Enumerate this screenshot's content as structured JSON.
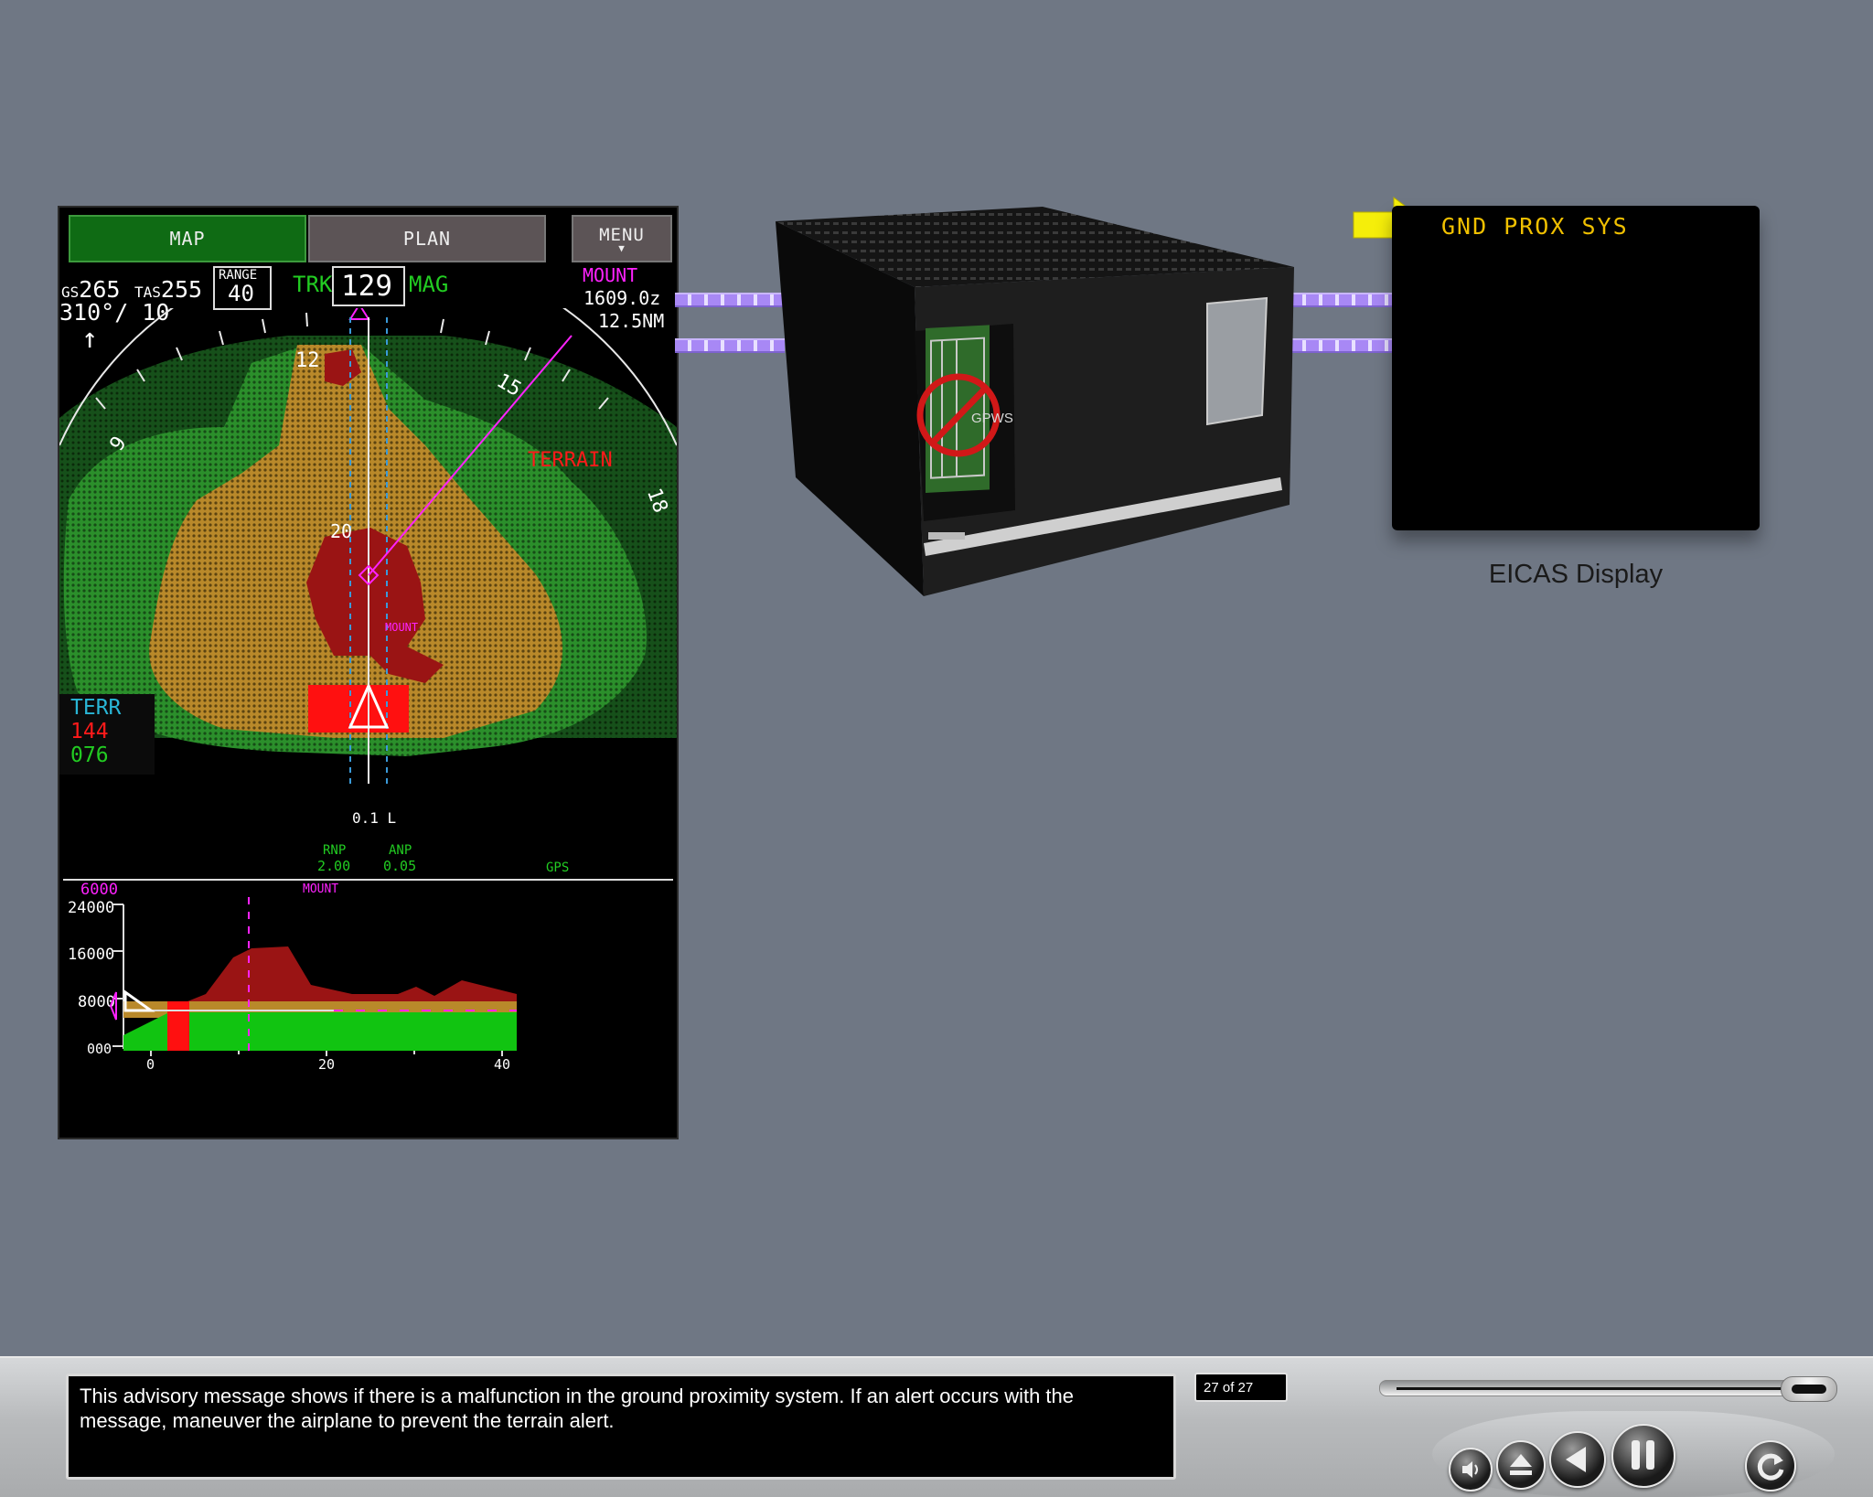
{
  "nd": {
    "buttons": {
      "map": "MAP",
      "plan": "PLAN",
      "menu": "MENU"
    },
    "gs_label": "GS",
    "gs_value": "265",
    "tas_label": "TAS",
    "tas_value": "255",
    "wind": "310°/ 10",
    "range_label": "RANGE",
    "range_value": "40",
    "trk_label": "TRK",
    "heading": "129",
    "mag_label": "MAG",
    "waypoint": {
      "name": "MOUNT",
      "time": "1609.0z",
      "dist": "12.5NM"
    },
    "compass_labels": [
      "12",
      "15",
      "9",
      "18"
    ],
    "terrain_label": "TERRAIN",
    "mount_map_label": "MOUNT",
    "mark_20": "20",
    "terr_box": {
      "label": "TERR",
      "high": "144",
      "low": "076"
    },
    "xtk": "0.1 L",
    "rnp_label": "RNP",
    "rnp_value": "2.00",
    "anp_label": "ANP",
    "anp_value": "0.05",
    "gps": "GPS",
    "vsd": {
      "alt_sel": "6000",
      "mount_label": "MOUNT",
      "y_labels": [
        "24000",
        "16000",
        "8000",
        "000"
      ],
      "x_labels": [
        "0",
        "20",
        "40"
      ]
    }
  },
  "unit_label": "GPWS",
  "eicas": {
    "message": "GND PROX SYS",
    "label": "EICAS Display"
  },
  "footer": {
    "caption": "This advisory message shows if there is a malfunction in the ground proximity system. If an alert occurs with the message, maneuver the airplane to prevent the terrain alert.",
    "counter": "27 of 27",
    "progress": 1.0
  },
  "colors": {
    "background": "#6f7784",
    "nd_green": "#22cc22",
    "nd_magenta": "#ff22ff",
    "terrain_red": "#ff1010",
    "eicas_amber": "#f0c000",
    "arrow_yellow": "#f5ee0a"
  }
}
